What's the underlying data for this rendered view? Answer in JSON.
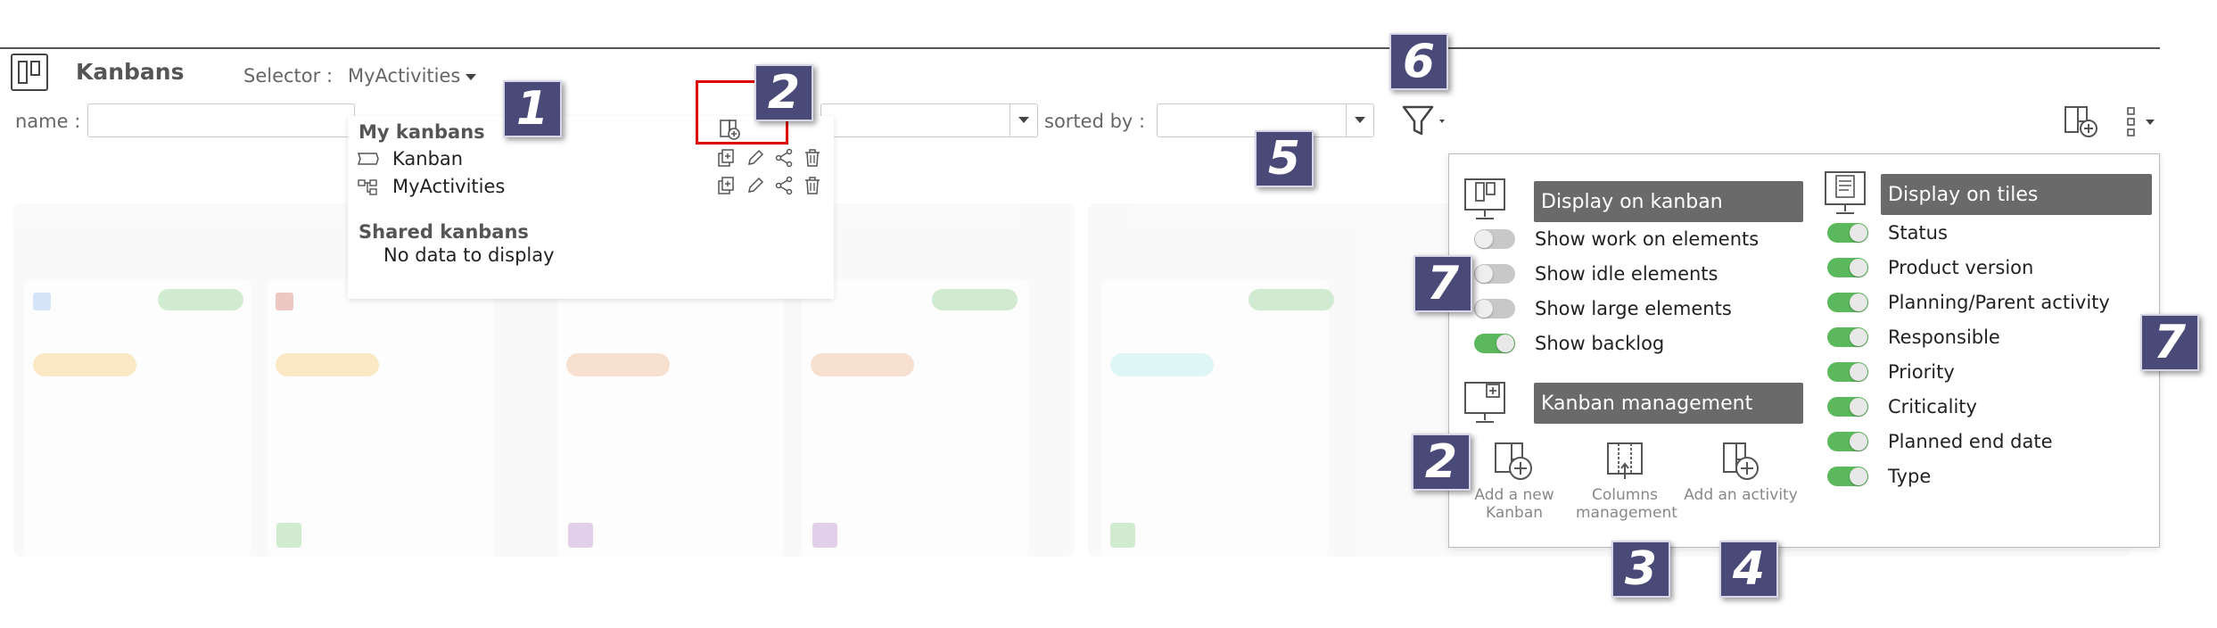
{
  "header": {
    "title": "Kanbans",
    "selector_label": "Selector :",
    "selector_value": "MyActivities",
    "name_label": "name :",
    "sorted_label": "sorted by :"
  },
  "dropdown": {
    "my_kanbans_heading": "My kanbans",
    "my_kanbans": [
      {
        "label": "Kanban"
      },
      {
        "label": "MyActivities"
      }
    ],
    "shared_heading": "Shared kanbans",
    "shared_empty": "No data to display"
  },
  "panel": {
    "display_on_kanban": {
      "header": "Display on kanban",
      "options": [
        {
          "label": "Show work on elements",
          "on": false
        },
        {
          "label": "Show idle elements",
          "on": false
        },
        {
          "label": "Show large elements",
          "on": false
        },
        {
          "label": "Show backlog",
          "on": true
        }
      ]
    },
    "kanban_management": {
      "header": "Kanban management",
      "actions": [
        {
          "label": "Add a new Kanban",
          "icon": "add-kanban-icon"
        },
        {
          "label": "Columns management",
          "icon": "columns-icon"
        },
        {
          "label": "Add an activity",
          "icon": "add-activity-icon"
        }
      ]
    },
    "display_on_tiles": {
      "header": "Display on tiles",
      "options": [
        {
          "label": "Status",
          "on": true
        },
        {
          "label": "Product version",
          "on": true
        },
        {
          "label": "Planning/Parent activity",
          "on": true
        },
        {
          "label": "Responsible",
          "on": true
        },
        {
          "label": "Priority",
          "on": true
        },
        {
          "label": "Criticality",
          "on": true
        },
        {
          "label": "Planned end date",
          "on": true
        },
        {
          "label": "Type",
          "on": true
        }
      ]
    }
  },
  "callouts": [
    "1",
    "2",
    "2",
    "3",
    "4",
    "5",
    "6",
    "7",
    "7"
  ],
  "colors": {
    "badge": "#4a4a78",
    "toggle_on": "#5cb85c",
    "toggle_off": "#c8c8c8",
    "section_header": "#6a6a6a",
    "highlight": "#e00000"
  }
}
